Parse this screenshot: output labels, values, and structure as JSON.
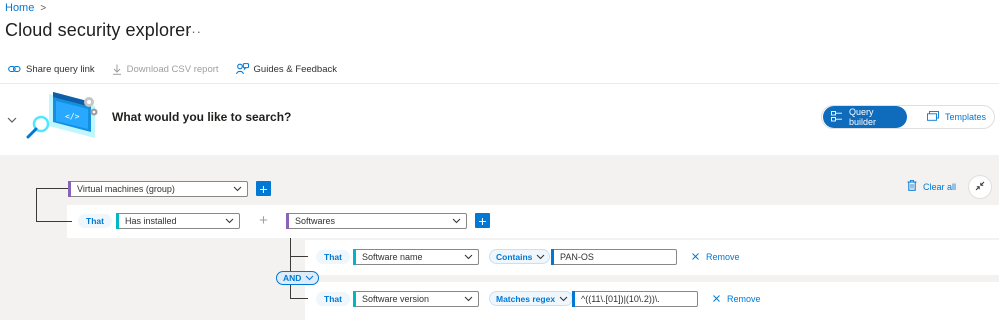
{
  "breadcrumb": {
    "home": "Home",
    "separator": ">"
  },
  "page": {
    "title": "Cloud security explorer",
    "more": "···"
  },
  "toolbar": {
    "share": "Share query link",
    "download": "Download CSV report",
    "guides": "Guides & Feedback"
  },
  "header": {
    "question": "What would you like to search?",
    "query_builder": "Query builder",
    "templates": "Templates"
  },
  "builder": {
    "root_select": "Virtual machines (group)",
    "that_label": "That",
    "relation_select": "Has installed",
    "target_select": "Softwares",
    "clear_all": "Clear all",
    "and_label": "AND",
    "conditions": [
      {
        "that": "That",
        "property": "Software name",
        "operator": "Contains",
        "value": "PAN-OS",
        "remove": "Remove"
      },
      {
        "that": "That",
        "property": "Software version",
        "operator": "Matches regex",
        "value": "^((11\\.[01])|(10\\.2))\\.",
        "remove": "Remove"
      }
    ]
  },
  "colors": {
    "accent": "#0078d4",
    "purple": "#8764b8",
    "teal": "#00b7c3"
  }
}
